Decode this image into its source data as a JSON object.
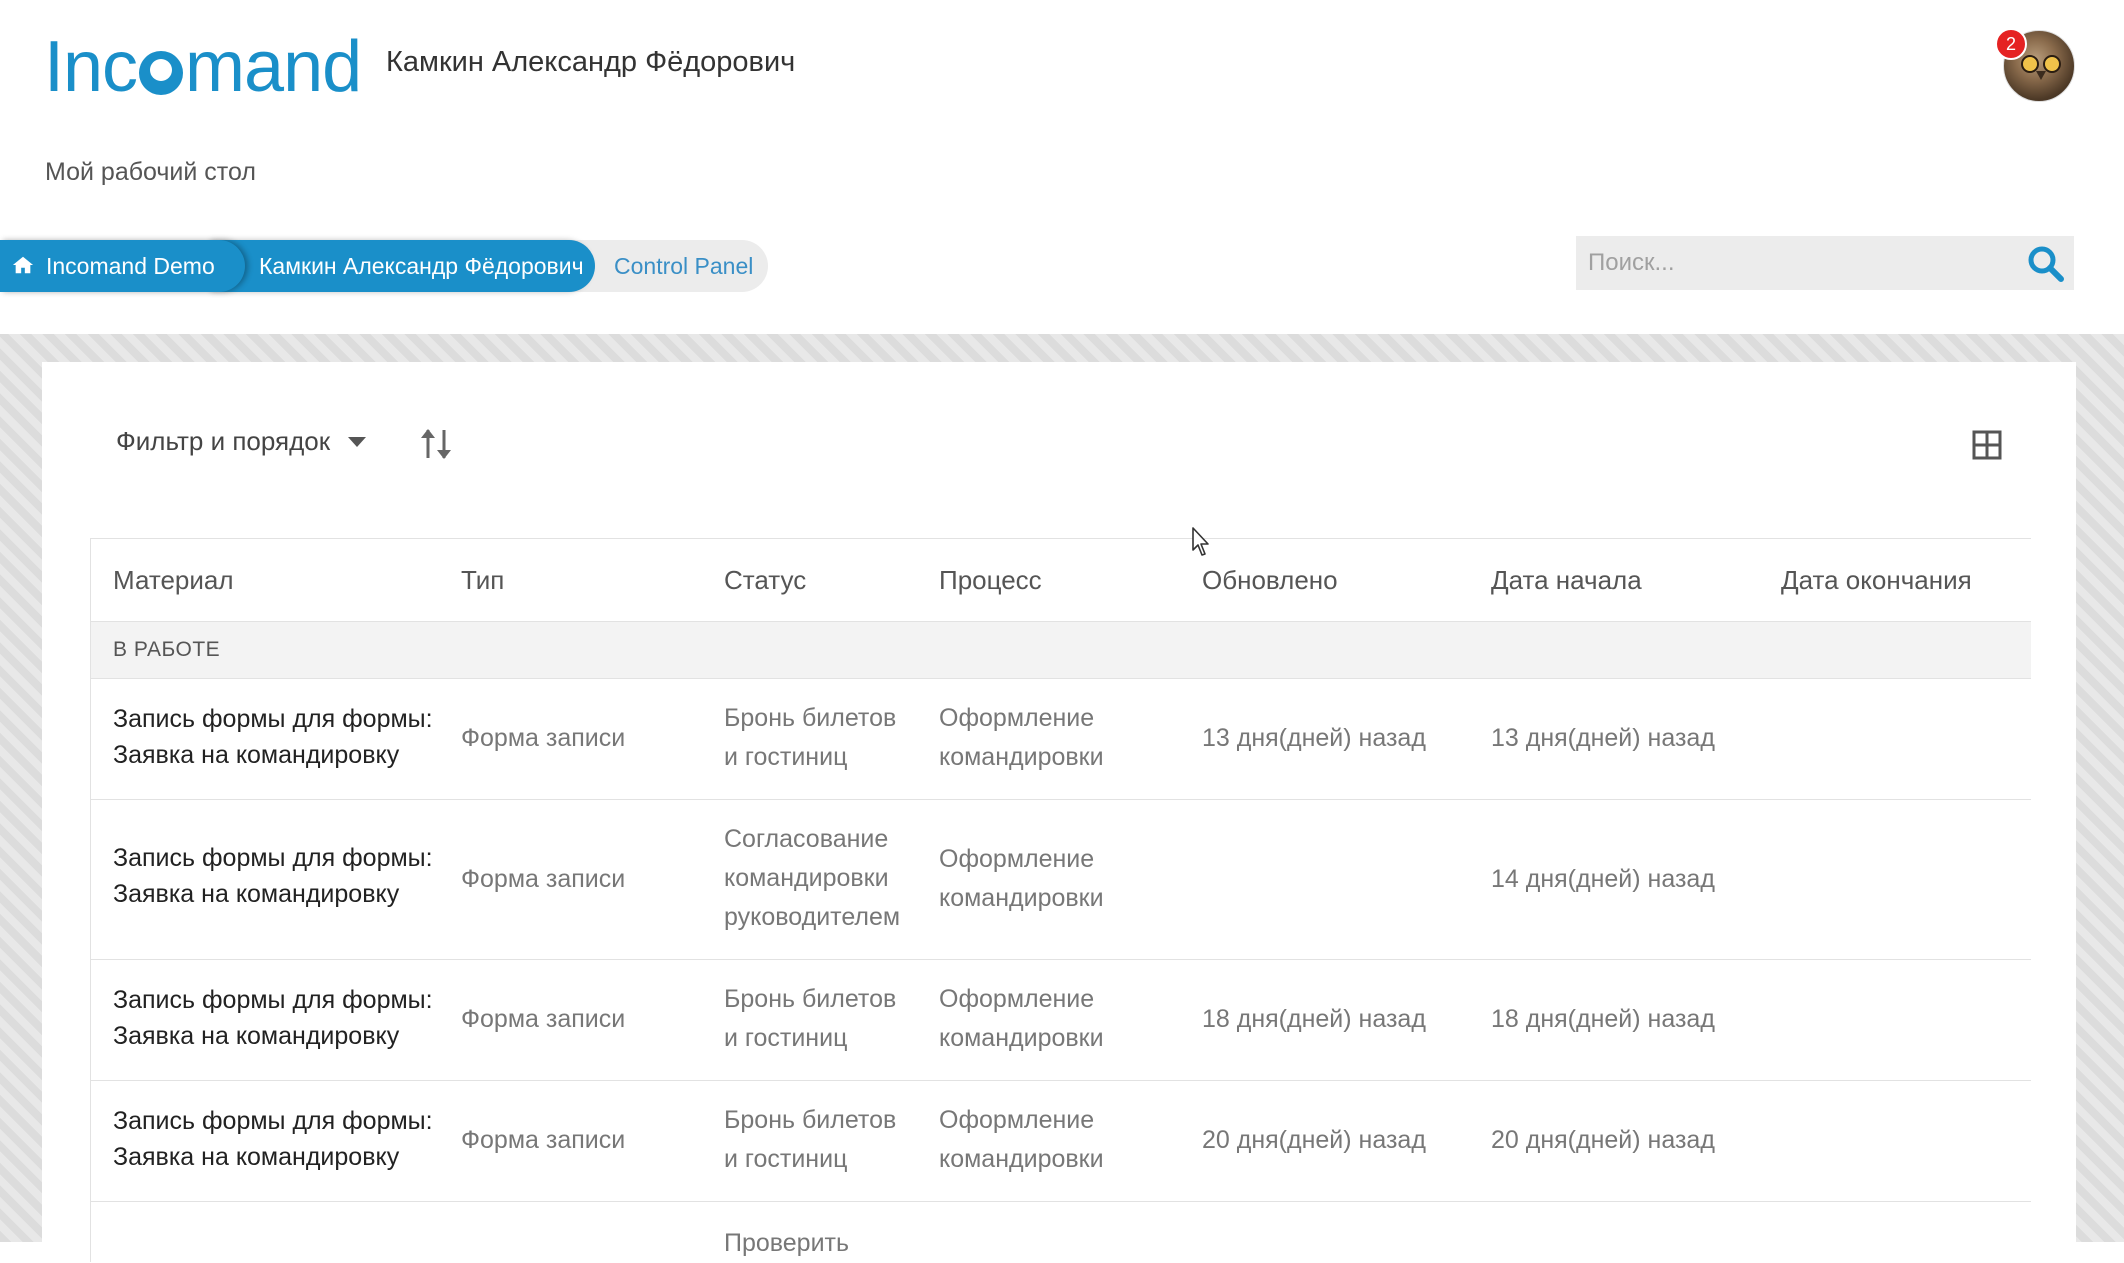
{
  "header": {
    "logo_text": "Incomand",
    "user_name": "Камкин Александр Фёдорович",
    "notifications_count": "2",
    "page_subtitle": "Мой рабочий стол"
  },
  "breadcrumb": [
    {
      "label": "Incomand Demo",
      "icon": "home-icon"
    },
    {
      "label": "Камкин Александр Фёдорович"
    },
    {
      "label": "Control Panel"
    }
  ],
  "search": {
    "placeholder": "Поиск..."
  },
  "toolbar": {
    "filter_label": "Фильтр и порядок",
    "sort_icon": "sort-arrows-icon",
    "view_icon": "grid-view-icon"
  },
  "table": {
    "columns": [
      "Материал",
      "Тип",
      "Статус",
      "Процесс",
      "Обновлено",
      "Дата начала",
      "Дата окончания"
    ],
    "group_label": "В РАБОТЕ",
    "rows": [
      {
        "material_1": "Запись формы для формы:",
        "material_2": "Заявка на командировку",
        "type": "Форма записи",
        "status_1": "Бронь билетов",
        "status_2": "и гостиниц",
        "status_3": "",
        "process_1": "Оформление",
        "process_2": "командировки",
        "updated": "13 дня(дней) назад",
        "start": "13 дня(дней) назад",
        "end": ""
      },
      {
        "material_1": "Запись формы для формы:",
        "material_2": "Заявка на командировку",
        "type": "Форма записи",
        "status_1": "Согласование",
        "status_2": "командировки",
        "status_3": "руководителем",
        "process_1": "Оформление",
        "process_2": "командировки",
        "updated": "",
        "start": "14 дня(дней) назад",
        "end": ""
      },
      {
        "material_1": "Запись формы для формы:",
        "material_2": "Заявка на командировку",
        "type": "Форма записи",
        "status_1": "Бронь билетов",
        "status_2": "и гостиниц",
        "status_3": "",
        "process_1": "Оформление",
        "process_2": "командировки",
        "updated": "18 дня(дней) назад",
        "start": "18 дня(дней) назад",
        "end": ""
      },
      {
        "material_1": "Запись формы для формы:",
        "material_2": "Заявка на командировку",
        "type": "Форма записи",
        "status_1": "Бронь билетов",
        "status_2": "и гостиниц",
        "status_3": "",
        "process_1": "Оформление",
        "process_2": "командировки",
        "updated": "20 дня(дней) назад",
        "start": "20 дня(дней) назад",
        "end": ""
      },
      {
        "material_1": "",
        "material_2": "",
        "type": "",
        "status_1": "Проверить",
        "status_2": "",
        "status_3": "",
        "process_1": "",
        "process_2": "",
        "updated": "",
        "start": "",
        "end": ""
      }
    ]
  },
  "colors": {
    "brand_blue": "#1a8fc9",
    "notification_red": "#e52222",
    "group_bg": "#f3f3f3"
  }
}
